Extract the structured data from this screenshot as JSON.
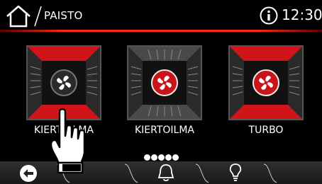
{
  "header": {
    "title": "PAISTO",
    "time": "12:30"
  },
  "modes": [
    {
      "label": "KIERTOILMA",
      "active_top": true,
      "active_bottom": true,
      "fan_style": "dark"
    },
    {
      "label": "KIERTOILMA",
      "active_top": false,
      "active_bottom": false,
      "fan_style": "red"
    },
    {
      "label": "TURBO",
      "active_top": true,
      "active_bottom": true,
      "fan_style": "red"
    }
  ],
  "pager": {
    "pages": 5,
    "current": 1
  },
  "icons": {
    "home": "home-icon",
    "info": "info-icon",
    "back": "back-icon",
    "bell": "bell-icon",
    "lamp": "lightbulb-icon",
    "hand": "touch-hand-icon"
  },
  "colors": {
    "accent": "#e8231a",
    "background": "#000000"
  }
}
